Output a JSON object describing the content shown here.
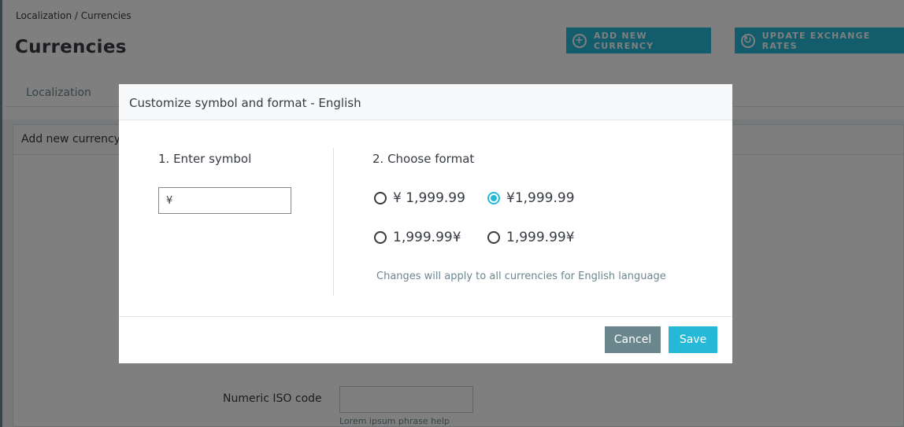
{
  "breadcrumb": "Localization / Currencies",
  "page_title": "Currencies",
  "toolbar": {
    "add_label": "ADD NEW CURRENCY",
    "add_icon": "plus-circle-icon",
    "update_label": "UPDATE EXCHANGE RATES",
    "update_icon": "refresh-icon"
  },
  "tabs": [
    {
      "label": "Localization"
    }
  ],
  "card": {
    "title": "Add new currency",
    "numeric_iso_label": "Numeric ISO code",
    "numeric_iso_value": "",
    "numeric_iso_help": "Lorem ipsum phrase help"
  },
  "modal": {
    "title": "Customize symbol and format - English",
    "symbol_section": "1. Enter symbol",
    "symbol_value": "¥",
    "format_section": "2. Choose format",
    "formats": [
      {
        "label": "¥ 1,999.99",
        "selected": false
      },
      {
        "label": "¥1,999.99",
        "selected": true
      },
      {
        "label": "1,999.99¥",
        "selected": false
      },
      {
        "label": "1,999.99¥",
        "selected": false
      }
    ],
    "format_help": "Changes will apply to all currencies for English language",
    "cancel_label": "Cancel",
    "save_label": "Save"
  },
  "colors": {
    "primary": "#25b9d7",
    "secondary": "#6c868e",
    "text": "#363a41"
  }
}
